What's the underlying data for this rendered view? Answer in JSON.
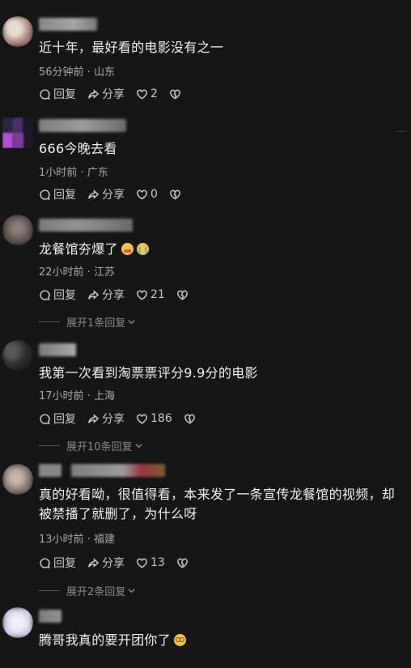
{
  "comments": [
    {
      "text": "近十年，最好看的电影没有之一",
      "time": "56分钟前",
      "location": "山东",
      "reply": "回复",
      "share": "分享",
      "likes": "2",
      "avatar_colors": [
        "#c9a9a0",
        "#7d5c58",
        "#e7ddd8"
      ],
      "name_colors": [
        "#9a9a9a",
        "#c0c0c0"
      ]
    },
    {
      "text": "666今晚去看",
      "time": "1小时前",
      "location": "广东",
      "reply": "回复",
      "share": "分享",
      "likes": "0",
      "avatar_colors": [
        "#4b2f6a",
        "#b44fd1",
        "#2a2540"
      ],
      "name_colors": [
        "#8f8f8f",
        "#b5b5b5"
      ]
    },
    {
      "text": "龙餐馆夯爆了",
      "time": "22小时前",
      "location": "江苏",
      "reply": "回复",
      "share": "分享",
      "likes": "21",
      "expand": "展开1条回复",
      "avatar_colors": [
        "#6a5e5c",
        "#3d3534",
        "#8a7f7c"
      ],
      "name_colors": [
        "#8a8a8a",
        "#a9a9a9"
      ]
    },
    {
      "text": "我第一次看到淘票票评分9.9分的电影",
      "time": "17小时前",
      "location": "上海",
      "reply": "回复",
      "share": "分享",
      "likes": "186",
      "expand": "展开10条回复",
      "avatar_colors": [
        "#2a2a2a",
        "#5a5a5a",
        "#1b1b1b"
      ],
      "name_colors": [
        "#8c8c8c",
        "#c4c4c4"
      ]
    },
    {
      "text": "真的好看呦，很值得看，本来发了一条宣传龙餐馆的视频，却被禁播了就删了，为什么呀",
      "time": "13小时前",
      "location": "福建",
      "reply": "回复",
      "share": "分享",
      "likes": "13",
      "expand": "展开2条回复",
      "avatar_colors": [
        "#8f7d78",
        "#c9b6ad",
        "#4d3f3b"
      ],
      "name_colors": [
        "#9b9b9b",
        "#b03a4a"
      ]
    },
    {
      "text": "腾哥我真的要开团你了",
      "avatar_colors": [
        "#d8d4e8",
        "#9aa0c0",
        "#f0eef5"
      ],
      "name_colors": [
        "#8f8f8f",
        "#a8a8a8"
      ]
    }
  ],
  "more_dots": "···"
}
